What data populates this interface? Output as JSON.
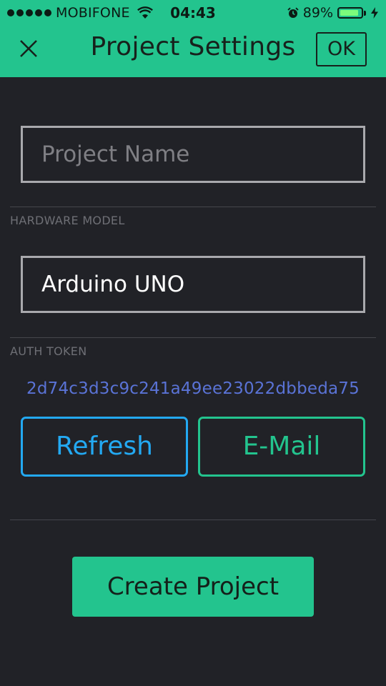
{
  "status_bar": {
    "carrier": "MOBIFONE",
    "time": "04:43",
    "battery_percent_label": "89%",
    "battery_level": 0.89
  },
  "header": {
    "title": "Project Settings",
    "ok_label": "OK",
    "background_color": "#23C48E"
  },
  "project_name": {
    "value": "",
    "placeholder": "Project Name"
  },
  "hardware_model": {
    "label": "HARDWARE MODEL",
    "value": "Arduino UNO"
  },
  "auth_token": {
    "label": "AUTH TOKEN",
    "value": "2d74c3d3c9c241a49ee23022dbbeda75"
  },
  "buttons": {
    "refresh": "Refresh",
    "email": "E-Mail",
    "create": "Create Project"
  },
  "colors": {
    "accent_green": "#23C48E",
    "accent_blue": "#23A9F2",
    "token_text": "#5A73D6",
    "background": "#212227"
  },
  "icons": {
    "close": "close-icon",
    "wifi": "wifi-icon",
    "alarm": "alarm-icon",
    "battery": "battery-icon",
    "charging": "charging-bolt-icon"
  }
}
